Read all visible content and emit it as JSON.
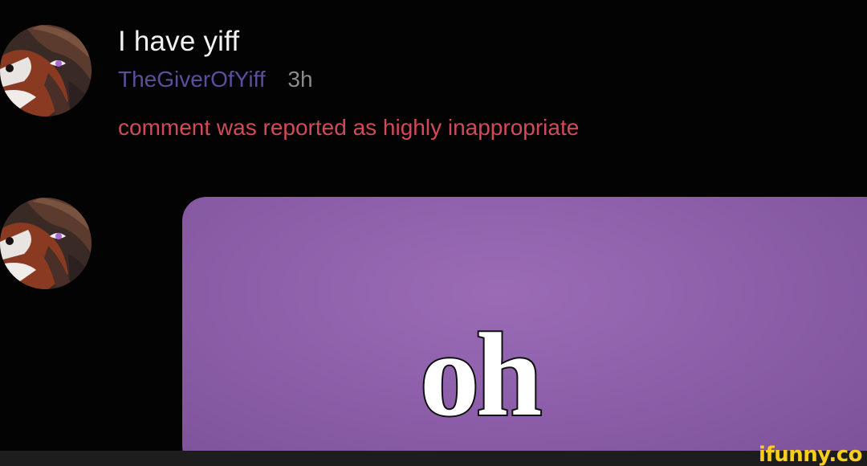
{
  "post": {
    "title": "I have yiff",
    "username": "TheGiverOfYiff",
    "timestamp": "3h",
    "notice": "comment was reported as highly inappropriate"
  },
  "reply": {
    "image_text": "oh"
  },
  "watermark": {
    "text": "ifunny.co"
  },
  "colors": {
    "background": "#030303",
    "username": "#5b4f9c",
    "notice": "#d14b56",
    "reply_image": "#8d5faa",
    "watermark": "#f8cd1c"
  },
  "icons": {
    "avatar": "fox-avatar",
    "watermark": "ifunny-logo"
  }
}
